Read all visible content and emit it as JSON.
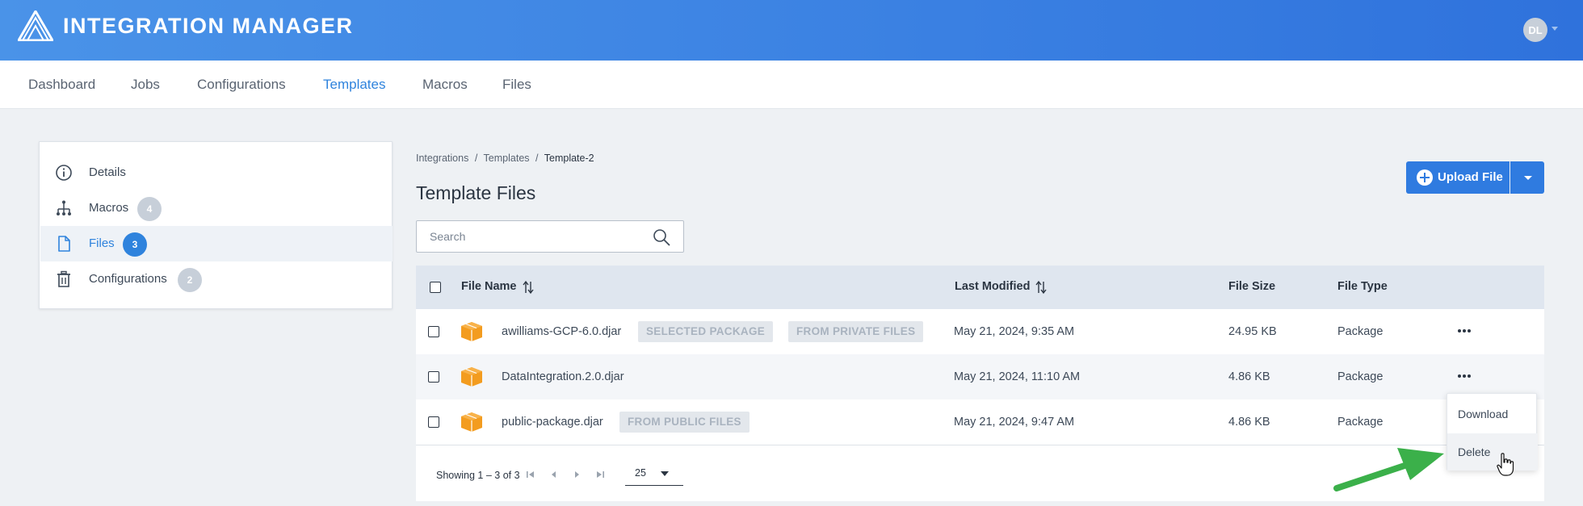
{
  "app": {
    "title": "INTEGRATION MANAGER",
    "user_initials": "DL"
  },
  "nav": {
    "items": [
      {
        "label": "Dashboard"
      },
      {
        "label": "Jobs"
      },
      {
        "label": "Configurations"
      },
      {
        "label": "Templates",
        "active": true
      },
      {
        "label": "Macros"
      },
      {
        "label": "Files"
      }
    ]
  },
  "sidebar": {
    "items": [
      {
        "label": "Details",
        "icon": "info-icon"
      },
      {
        "label": "Macros",
        "icon": "hierarchy-icon",
        "count": "4"
      },
      {
        "label": "Files",
        "icon": "file-icon",
        "count": "3",
        "active": true
      },
      {
        "label": "Configurations",
        "icon": "trash-icon",
        "count": "2"
      }
    ]
  },
  "breadcrumb": {
    "items": [
      "Integrations",
      "/",
      "Templates",
      "/",
      "Template-2"
    ]
  },
  "page": {
    "title": "Template Files"
  },
  "search": {
    "placeholder": "Search",
    "value": ""
  },
  "upload": {
    "label": "Upload File"
  },
  "table": {
    "columns": [
      "File Name",
      "Last Modified",
      "File Size",
      "File Type"
    ],
    "rows": [
      {
        "name": "awilliams-GCP-6.0.djar",
        "tags": [
          "SELECTED PACKAGE",
          "FROM PRIVATE FILES"
        ],
        "modified": "May 21, 2024, 9:35 AM",
        "size": "24.95 KB",
        "type": "Package"
      },
      {
        "name": "DataIntegration.2.0.djar",
        "tags": [],
        "modified": "May 21, 2024, 11:10 AM",
        "size": "4.86 KB",
        "type": "Package"
      },
      {
        "name": "public-package.djar",
        "tags": [
          "FROM PUBLIC FILES"
        ],
        "modified": "May 21, 2024, 9:47 AM",
        "size": "4.86 KB",
        "type": "Package"
      }
    ]
  },
  "pagination": {
    "showing": "Showing 1 – 3 of 3",
    "per_page": "25"
  },
  "context_menu": {
    "items": [
      {
        "label": "Download"
      },
      {
        "label": "Delete",
        "hover": true
      }
    ]
  },
  "colors": {
    "header_start": "#4a93e8",
    "header_end": "#2f72dc",
    "accent": "#2f83dd",
    "package_icon": "#f39c1f",
    "annotation_arrow": "#3bb04a"
  }
}
